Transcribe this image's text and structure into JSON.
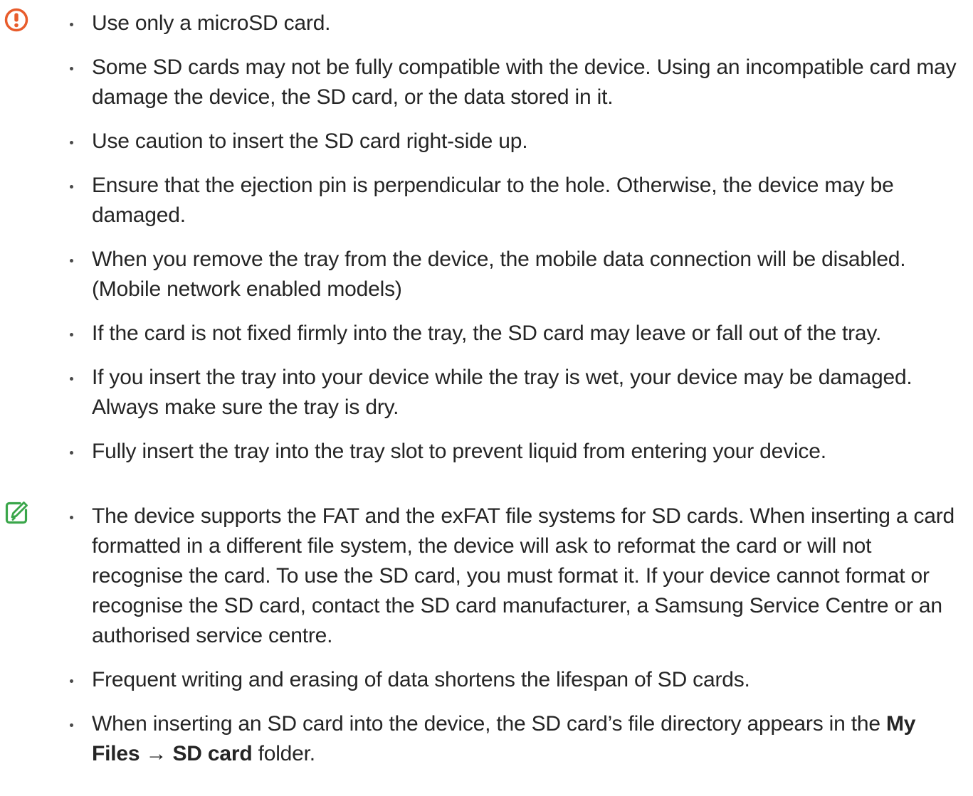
{
  "caution": {
    "icon": "caution-icon",
    "color": "#e85c2c",
    "items": [
      "Use only a microSD card.",
      "Some SD cards may not be fully compatible with the device. Using an incompatible card may damage the device, the SD card, or the data stored in it.",
      "Use caution to insert the SD card right-side up.",
      "Ensure that the ejection pin is perpendicular to the hole. Otherwise, the device may be damaged.",
      "When you remove the tray from the device, the mobile data connection will be disabled. (Mobile network enabled models)",
      "If the card is not fixed firmly into the tray, the SD card may leave or fall out of the tray.",
      "If you insert the tray into your device while the tray is wet, your device may be damaged. Always make sure the tray is dry.",
      "Fully insert the tray into the tray slot to prevent liquid from entering your device."
    ]
  },
  "note": {
    "icon": "note-icon",
    "color": "#3aa64a",
    "items": [
      "The device supports the FAT and the exFAT file systems for SD cards. When inserting a card formatted in a different file system, the device will ask to reformat the card or will not recognise the card. To use the SD card, you must format it. If your device cannot format or recognise the SD card, contact the SD card manufacturer, a Samsung Service Centre or an authorised service centre.",
      "Frequent writing and erasing of data shortens the lifespan of SD cards."
    ],
    "last_item": {
      "prefix": "When inserting an SD card into the device, the SD card’s file directory appears in the ",
      "menu_1": "My Files",
      "arrow": "→",
      "menu_2": "SD card",
      "suffix": " folder."
    }
  }
}
